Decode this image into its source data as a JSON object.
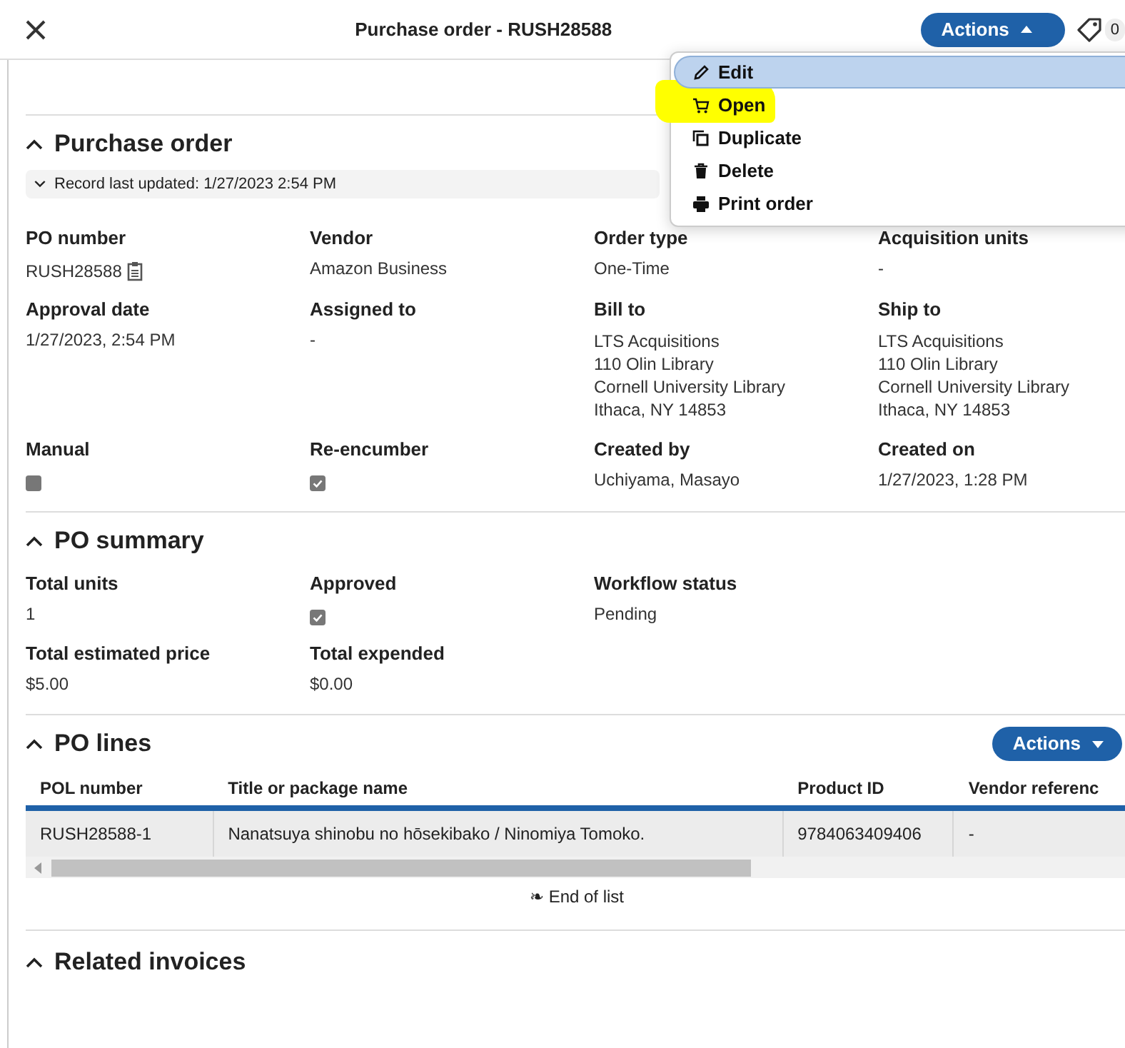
{
  "header": {
    "title": "Purchase order - RUSH28588",
    "actions_label": "Actions",
    "tag_count": "0"
  },
  "actions_menu": [
    {
      "label": "Edit",
      "kind": "edit",
      "selected": true,
      "highlighted": false
    },
    {
      "label": "Open",
      "kind": "open",
      "selected": false,
      "highlighted": true
    },
    {
      "label": "Duplicate",
      "kind": "duplicate",
      "selected": false,
      "highlighted": false
    },
    {
      "label": "Delete",
      "kind": "delete",
      "selected": false,
      "highlighted": false
    },
    {
      "label": "Print order",
      "kind": "print",
      "selected": false,
      "highlighted": false
    }
  ],
  "purchase_order": {
    "title": "Purchase order",
    "record_updated": "Record last updated: 1/27/2023 2:54 PM",
    "rows": [
      [
        {
          "label": "PO number",
          "kind": "copy",
          "value": "RUSH28588"
        },
        {
          "label": "Vendor",
          "kind": "text",
          "value": "Amazon Business"
        },
        {
          "label": "Order type",
          "kind": "text",
          "value": "One-Time"
        },
        {
          "label": "Acquisition units",
          "kind": "text",
          "value": "-"
        }
      ],
      [
        {
          "label": "Approval date",
          "kind": "text",
          "value": "1/27/2023, 2:54 PM"
        },
        {
          "label": "Assigned to",
          "kind": "text",
          "value": "-"
        },
        {
          "label": "Bill to",
          "kind": "lines",
          "lines": [
            "LTS Acquisitions",
            "110 Olin Library",
            "Cornell University Library",
            "Ithaca, NY 14853"
          ]
        },
        {
          "label": "Ship to",
          "kind": "lines",
          "lines": [
            "LTS Acquisitions",
            "110 Olin Library",
            "Cornell University Library",
            "Ithaca, NY 14853"
          ]
        }
      ],
      [
        {
          "label": "Manual",
          "kind": "checkbox",
          "checked": false
        },
        {
          "label": "Re-encumber",
          "kind": "checkbox",
          "checked": true
        },
        {
          "label": "Created by",
          "kind": "text",
          "value": "Uchiyama, Masayo"
        },
        {
          "label": "Created on",
          "kind": "text",
          "value": "1/27/2023, 1:28 PM"
        }
      ]
    ]
  },
  "po_summary": {
    "title": "PO summary",
    "rows": [
      [
        {
          "label": "Total units",
          "kind": "text",
          "value": "1"
        },
        {
          "label": "Approved",
          "kind": "checkbox",
          "checked": true
        },
        {
          "label": "Workflow status",
          "kind": "text",
          "value": "Pending"
        }
      ],
      [
        {
          "label": "Total estimated price",
          "kind": "text",
          "value": "$5.00"
        },
        {
          "label": "Total expended",
          "kind": "text",
          "value": "$0.00"
        }
      ]
    ]
  },
  "po_lines": {
    "title": "PO lines",
    "actions_label": "Actions",
    "columns": [
      "POL number",
      "Title or package name",
      "Product ID",
      "Vendor referenc"
    ],
    "rows": [
      [
        "RUSH28588-1",
        "Nanatsuya shinobu no hōsekibako / Ninomiya Tomoko.",
        "9784063409406",
        "-"
      ]
    ],
    "end_of_list": "End of list",
    "end_icon": "❧"
  },
  "related_invoices": {
    "title": "Related invoices"
  }
}
